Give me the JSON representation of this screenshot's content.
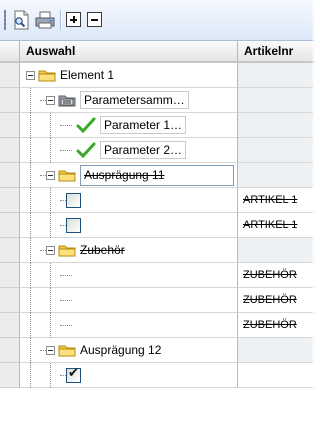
{
  "toolbar": {
    "buttons": [
      {
        "name": "page-preview-icon"
      },
      {
        "name": "printer-icon"
      },
      {
        "name": "expand-all-icon",
        "glyph": "+"
      },
      {
        "name": "collapse-all-icon",
        "glyph": "−"
      }
    ]
  },
  "grid": {
    "headers": {
      "col1": "Auswahl",
      "col2": "Artikelnr"
    },
    "rows": [
      {
        "label": "Element 1",
        "col2": ""
      },
      {
        "label": "Parametersamm…",
        "col2": ""
      },
      {
        "label": "Parameter 1…",
        "col2": ""
      },
      {
        "label": "Parameter 2…",
        "col2": ""
      },
      {
        "label": "Ausprägung 11",
        "col2": ""
      },
      {
        "label": "",
        "col2": "ARTIKEL 1"
      },
      {
        "label": "",
        "col2": "ARTIKEL 1"
      },
      {
        "label": "Zubehör",
        "col2": ""
      },
      {
        "label": "",
        "col2": "ZUBEHÖR"
      },
      {
        "label": "",
        "col2": "ZUBEHÖR"
      },
      {
        "label": "",
        "col2": "ZUBEHÖR"
      },
      {
        "label": "Ausprägung 12",
        "col2": ""
      },
      {
        "label": "",
        "col2": ""
      }
    ]
  },
  "colors": {
    "folder": "#f3cc45",
    "check": "#3aa829",
    "toolbar_bg": "#dce7f7"
  }
}
